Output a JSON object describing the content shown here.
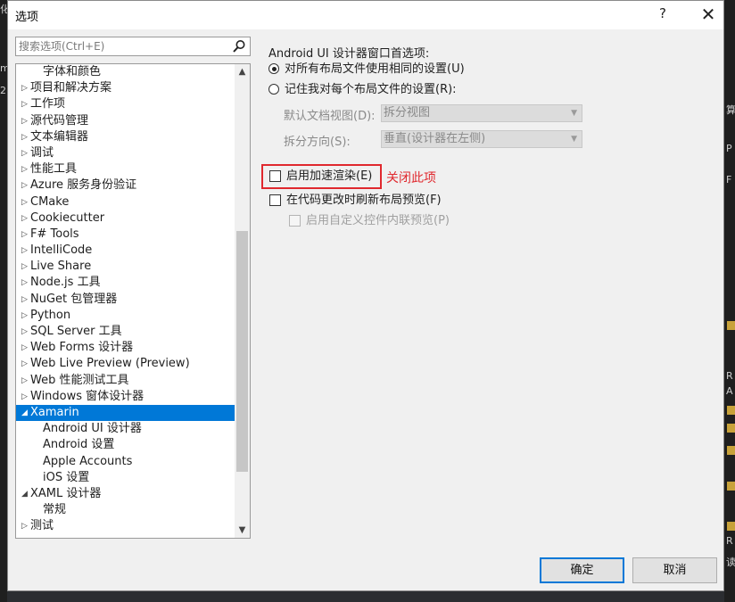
{
  "background": {
    "left_fragments": [
      "化",
      "m",
      "2"
    ],
    "right_fragments": [
      "算",
      "P",
      "F",
      "R",
      "A",
      "R",
      "读"
    ]
  },
  "dialog": {
    "title": "选项",
    "help_label": "?",
    "close_label": "✕"
  },
  "search": {
    "placeholder": "搜索选项(Ctrl+E)",
    "value": ""
  },
  "tree": {
    "items": [
      {
        "label": "字体和颜色",
        "arrow": "",
        "child": true
      },
      {
        "label": "项目和解决方案",
        "arrow": "▷"
      },
      {
        "label": "工作项",
        "arrow": "▷"
      },
      {
        "label": "源代码管理",
        "arrow": "▷"
      },
      {
        "label": "文本编辑器",
        "arrow": "▷"
      },
      {
        "label": "调试",
        "arrow": "▷"
      },
      {
        "label": "性能工具",
        "arrow": "▷"
      },
      {
        "label": "Azure 服务身份验证",
        "arrow": "▷"
      },
      {
        "label": "CMake",
        "arrow": "▷"
      },
      {
        "label": "Cookiecutter",
        "arrow": "▷"
      },
      {
        "label": "F# Tools",
        "arrow": "▷"
      },
      {
        "label": "IntelliCode",
        "arrow": "▷"
      },
      {
        "label": "Live Share",
        "arrow": "▷"
      },
      {
        "label": "Node.js 工具",
        "arrow": "▷"
      },
      {
        "label": "NuGet 包管理器",
        "arrow": "▷"
      },
      {
        "label": "Python",
        "arrow": "▷"
      },
      {
        "label": "SQL Server 工具",
        "arrow": "▷"
      },
      {
        "label": "Web Forms 设计器",
        "arrow": "▷"
      },
      {
        "label": "Web Live Preview (Preview)",
        "arrow": "▷"
      },
      {
        "label": "Web 性能测试工具",
        "arrow": "▷"
      },
      {
        "label": "Windows 窗体设计器",
        "arrow": "▷"
      },
      {
        "label": "Xamarin",
        "arrow": "◢",
        "selected": true
      },
      {
        "label": "Android UI 设计器",
        "arrow": "",
        "child": true
      },
      {
        "label": "Android 设置",
        "arrow": "",
        "child": true
      },
      {
        "label": "Apple Accounts",
        "arrow": "",
        "child": true
      },
      {
        "label": "iOS 设置",
        "arrow": "",
        "child": true
      },
      {
        "label": "XAML 设计器",
        "arrow": "◢"
      },
      {
        "label": "常规",
        "arrow": "",
        "child": true
      },
      {
        "label": "测试",
        "arrow": "▷"
      }
    ],
    "scroll_up": "▲",
    "scroll_down": "▼"
  },
  "options": {
    "heading": "Android UI 设计器窗口首选项:",
    "radio_same": "对所有布局文件使用相同的设置(U)",
    "radio_remember": "记住我对每个布局文件的设置(R):",
    "default_view_label": "默认文档视图(D):",
    "default_view_value": "拆分视图",
    "split_dir_label": "拆分方向(S):",
    "split_dir_value": "垂直(设计器在左侧)",
    "accel_render": "启用加速渲染(E)",
    "refresh_preview": "在代码更改时刷新布局预览(F)",
    "custom_inline": "启用自定义控件内联预览(P)",
    "annotation": "关闭此项"
  },
  "buttons": {
    "ok": "确定",
    "cancel": "取消"
  },
  "colors": {
    "selection": "#0078d7",
    "annotation_red": "#e0282e"
  }
}
